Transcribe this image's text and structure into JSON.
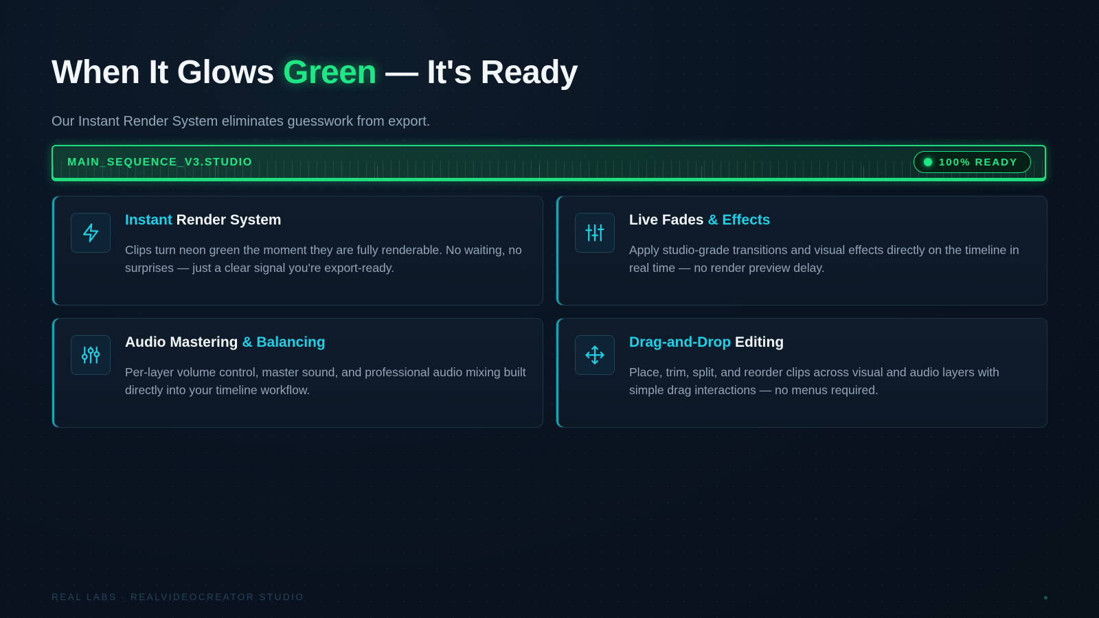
{
  "heading": {
    "before": "When It Glows ",
    "highlight": "Green",
    "after": " — It's Ready"
  },
  "subtitle": "Our Instant Render System eliminates guesswork from export.",
  "timeline": {
    "sequence_name": "MAIN_SEQUENCE_V3.STUDIO",
    "status": "100% READY",
    "status_color": "#1ee884"
  },
  "features": [
    {
      "icon": "lightning-icon",
      "title_accent": "Instant",
      "title_rest": " Render System",
      "description": "Clips turn neon green the moment they are fully renderable. No waiting, no surprises — just a clear signal you're export-ready."
    },
    {
      "icon": "sliders-icon",
      "title_rest": "Live Fades ",
      "title_accent": "& Effects",
      "description": "Apply studio-grade transitions and visual effects directly on the timeline in real time — no render preview delay."
    },
    {
      "icon": "mixer-icon",
      "title_rest": "Audio Mastering ",
      "title_accent": "& Balancing",
      "description": "Per-layer volume control, master sound, and professional audio mixing built directly into your timeline workflow."
    },
    {
      "icon": "move-arrows-icon",
      "title_accent": "Drag-and-Drop",
      "title_rest": " Editing",
      "description": "Place, trim, split, and reorder clips across visual and audio layers with simple drag interactions — no menus required."
    }
  ],
  "footer": "REAL LABS · REALVIDEOCREATOR STUDIO",
  "colors": {
    "accent_green": "#1ee884",
    "accent_cyan": "#1fd0e6",
    "background": "#0a1422"
  }
}
